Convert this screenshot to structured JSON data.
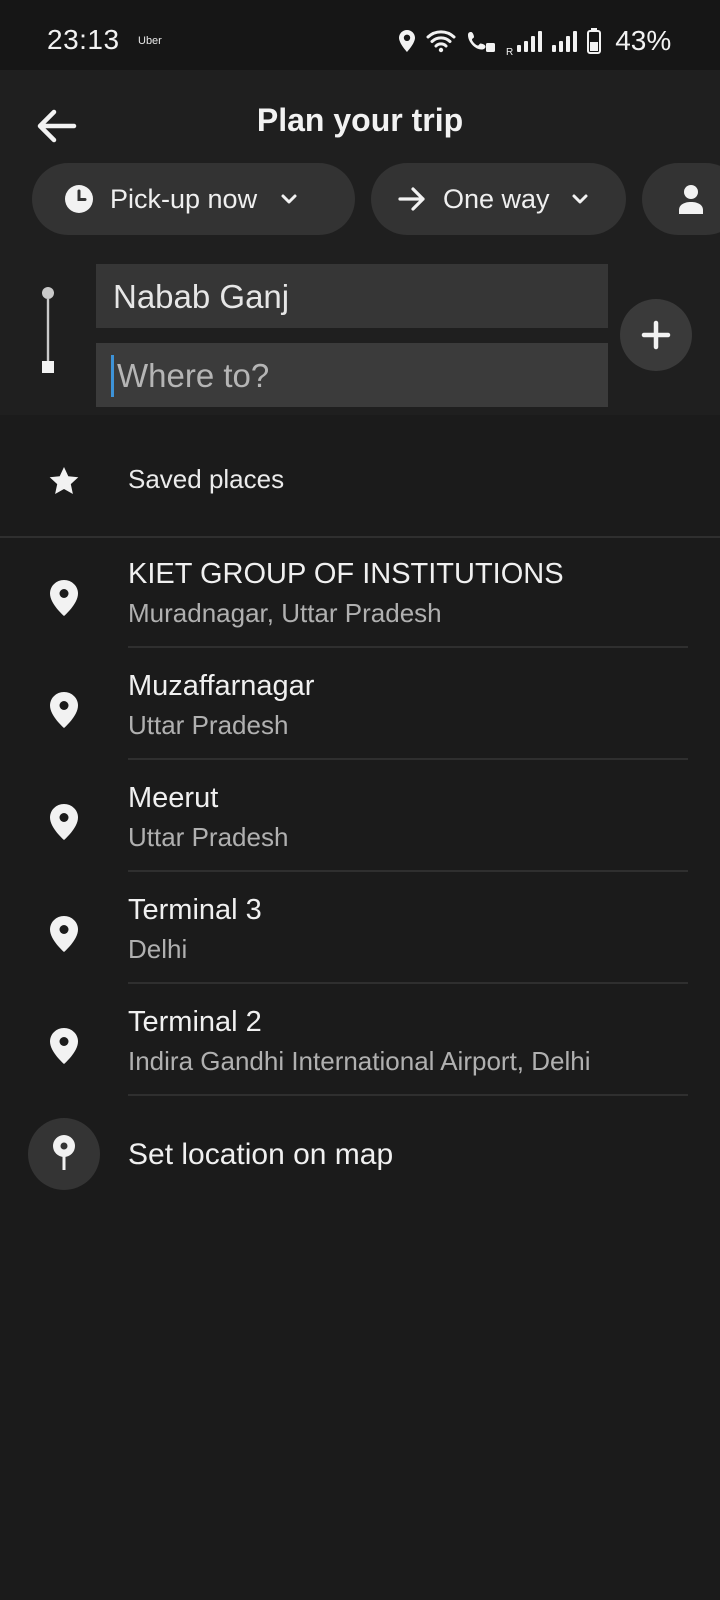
{
  "status_bar": {
    "time": "23:13",
    "app_label": "Uber",
    "battery": "43%",
    "roaming_mark": "R"
  },
  "header": {
    "title": "Plan your trip",
    "back_icon": "arrow-left-icon"
  },
  "chips": [
    {
      "label": "Pick-up now",
      "icon": "clock-icon",
      "trailing": "chevron-down-icon"
    },
    {
      "label": "One way",
      "icon": "arrow-right-icon",
      "trailing": "chevron-down-icon"
    },
    {
      "label": "",
      "icon": "person-icon"
    }
  ],
  "route": {
    "pickup_value": "Nabab Ganj",
    "destination_placeholder": "Where to?",
    "add_stop_icon": "plus-icon"
  },
  "saved_places": {
    "label": "Saved places",
    "icon": "star-icon"
  },
  "places": [
    {
      "name": "KIET GROUP OF INSTITUTIONS",
      "sub": "Muradnagar, Uttar Pradesh"
    },
    {
      "name": "Muzaffarnagar",
      "sub": "Uttar Pradesh"
    },
    {
      "name": "Meerut",
      "sub": "Uttar Pradesh"
    },
    {
      "name": "Terminal 3",
      "sub": "Delhi"
    },
    {
      "name": "Terminal 2",
      "sub": "Indira Gandhi International Airport, Delhi"
    }
  ],
  "map_option": {
    "label": "Set location on map",
    "icon": "map-pin-icon"
  },
  "colors": {
    "background": "#1b1b1b",
    "header_background": "#1f1f1f",
    "chip_background": "#333333",
    "field_background": "#363636",
    "caret": "#3d93d8"
  }
}
